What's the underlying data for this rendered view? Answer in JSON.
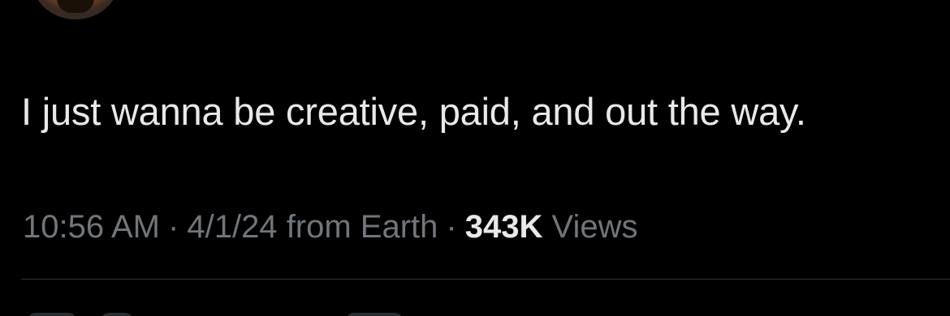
{
  "tweet": {
    "text": "I just wanna be creative, paid, and out the way.",
    "time": "10:56 AM",
    "date": "4/1/24",
    "source": "from Earth",
    "separator": "·",
    "views_count": "343K",
    "views_label": "Views"
  },
  "colors": {
    "background": "#000000",
    "text_primary": "#e7e9ea",
    "text_secondary": "#71767b",
    "divider": "#2f3336"
  }
}
